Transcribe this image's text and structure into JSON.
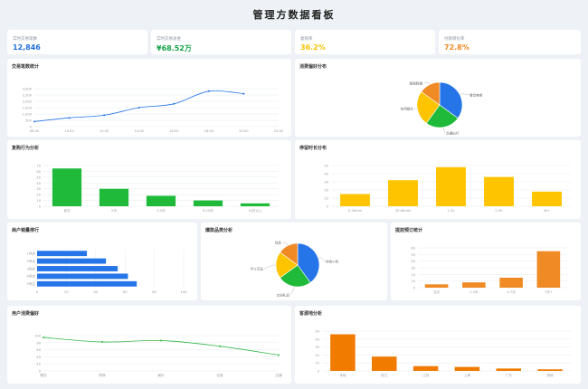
{
  "page": {
    "title": "管理方数据看板"
  },
  "kpis": [
    {
      "label": "实时交易笔数",
      "value": "12,846",
      "color": "#1e6fd9"
    },
    {
      "label": "实时交易总金",
      "value": "¥68.52万",
      "color": "#16a34a"
    },
    {
      "label": "复购率",
      "value": "36.2%",
      "color": "#f5c400"
    },
    {
      "label": "付款转化率",
      "value": "72.8%",
      "color": "#f08a24"
    }
  ],
  "colors": {
    "blue": "#2575e8",
    "green": "#1fba3a",
    "yellow": "#ffc400",
    "orange": "#f08a24",
    "deep_orange": "#f07b00",
    "line_green": "#35b84a"
  },
  "chart_data": [
    {
      "id": "trade",
      "type": "line",
      "title": "交易笔数统计",
      "x": [
        "08:00",
        "10:00",
        "12:00",
        "14:00",
        "16:00",
        "18:00",
        "20:00",
        "22:00"
      ],
      "values": [
        400,
        700,
        900,
        1500,
        1800,
        2800,
        2600
      ],
      "x_index": [
        0,
        1,
        2,
        3,
        4,
        5,
        6
      ],
      "yticks": [
        "3,000",
        "2,500",
        "2,000",
        "1,500",
        "1,000",
        "500",
        "0"
      ],
      "ylim": [
        0,
        3000
      ]
    },
    {
      "id": "pref_pie",
      "type": "pie",
      "title": "消费偏好分布",
      "labels": [
        "餐饮美食",
        "交通出行",
        "休闲娱乐",
        "服装鞋帽"
      ],
      "values": [
        35,
        25,
        25,
        15
      ],
      "colors": [
        "#2575e8",
        "#1fba3a",
        "#ffc400",
        "#f08a24"
      ]
    },
    {
      "id": "purchase",
      "type": "bar",
      "title": "复购行为分析",
      "categories": [
        "首次",
        "2次",
        "3-5次",
        "6-10次",
        "10次以上"
      ],
      "values": [
        65,
        30,
        18,
        10,
        5
      ],
      "yticks": [
        "70",
        "60",
        "50",
        "40",
        "30",
        "20",
        "10",
        "0"
      ],
      "ylim": [
        0,
        70
      ]
    },
    {
      "id": "dwell",
      "type": "bar",
      "title": "停留时长分布",
      "categories": [
        "0-30min",
        "30-60min",
        "1-2h",
        "2-4h",
        "4h+"
      ],
      "values": [
        15,
        32,
        48,
        36,
        18
      ],
      "yticks": [
        "50",
        "40",
        "30",
        "20",
        "10",
        "0"
      ],
      "ylim": [
        0,
        50
      ]
    },
    {
      "id": "merchant",
      "type": "bar",
      "title": "商户销量排行",
      "categories": [
        "1号店",
        "2号店",
        "3号店",
        "4号店",
        "5号店"
      ],
      "values": [
        34,
        47,
        55,
        62,
        68
      ],
      "xticks": [
        "0",
        "20",
        "40",
        "60",
        "80",
        "100"
      ],
      "xlim": [
        0,
        100
      ]
    },
    {
      "id": "explode_pie",
      "type": "pie",
      "title": "爆款品类分析",
      "labels": [
        "特色小吃",
        "文创礼品",
        "手工艺品",
        "饮品"
      ],
      "values": [
        40,
        25,
        20,
        15
      ],
      "colors": [
        "#2575e8",
        "#1fba3a",
        "#ffc400",
        "#f08a24"
      ]
    },
    {
      "id": "booking",
      "type": "bar",
      "title": "提前预订统计",
      "categories": [
        "当天",
        "1-3天",
        "4-7天",
        "7天+"
      ],
      "values": [
        5,
        8,
        15,
        55
      ],
      "yticks": [
        "60",
        "50",
        "40",
        "30",
        "20",
        "10",
        "0"
      ],
      "ylim": [
        0,
        60
      ]
    },
    {
      "id": "user_pref",
      "type": "line",
      "title": "用户消费偏好",
      "x": [
        "餐饮",
        "购物",
        "娱乐",
        "住宿",
        "交通"
      ],
      "values": [
        95,
        82,
        86,
        70,
        45
      ],
      "yticks": [
        "100",
        "80",
        "60",
        "40",
        "20",
        "0"
      ],
      "ylim": [
        0,
        100
      ]
    },
    {
      "id": "source",
      "type": "bar",
      "title": "客源地分析",
      "categories": [
        "本地",
        "浙江",
        "江苏",
        "上海",
        "广东",
        "其他"
      ],
      "values": [
        46,
        18,
        6,
        5,
        3,
        2
      ],
      "yticks": [
        "50",
        "40",
        "30",
        "20",
        "10",
        "0"
      ],
      "ylim": [
        0,
        50
      ]
    }
  ]
}
